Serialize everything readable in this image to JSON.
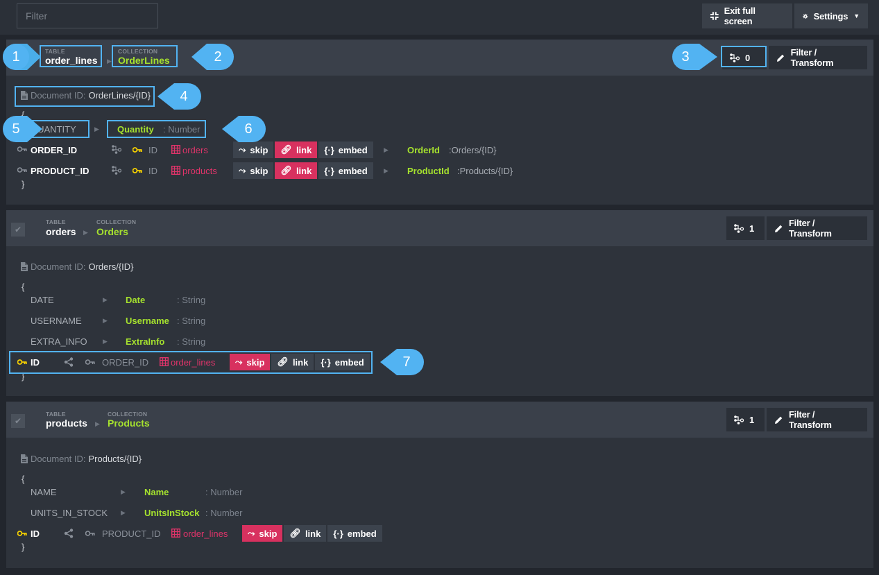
{
  "toolbar": {
    "filter_placeholder": "Filter",
    "exit_fullscreen_label": "Exit full screen",
    "settings_label": "Settings"
  },
  "panels": [
    {
      "table_caption": "TABLE",
      "table_name": "order_lines",
      "collection_caption": "COLLECTION",
      "collection_name": "OrderLines",
      "relations_count": "0",
      "filter_label": "Filter / Transform",
      "docid_label": "Document ID:",
      "docid_value": "OrderLines/{ID}",
      "brace_open": "{",
      "brace_close": "}",
      "fields": [
        {
          "column": "QUANTITY",
          "property": "Quantity",
          "type": ": Number"
        }
      ],
      "links": [
        {
          "column": "ORDER_ID",
          "key": "ID",
          "target": "orders",
          "skip": "skip",
          "link": "link",
          "embed": "embed",
          "property": "OrderId",
          "value": ":Orders/{ID}"
        },
        {
          "column": "PRODUCT_ID",
          "key": "ID",
          "target": "products",
          "skip": "skip",
          "link": "link",
          "embed": "embed",
          "property": "ProductId",
          "value": ":Products/{ID}"
        }
      ]
    },
    {
      "table_caption": "TABLE",
      "table_name": "orders",
      "collection_caption": "COLLECTION",
      "collection_name": "Orders",
      "relations_count": "1",
      "filter_label": "Filter / Transform",
      "docid_label": "Document ID:",
      "docid_value": "Orders/{ID}",
      "brace_open": "{",
      "brace_close": "}",
      "fields": [
        {
          "column": "DATE",
          "property": "Date",
          "type": ": String"
        },
        {
          "column": "USERNAME",
          "property": "Username",
          "type": ": String"
        },
        {
          "column": "EXTRA_INFO",
          "property": "ExtraInfo",
          "type": ": String"
        }
      ],
      "relation": {
        "pk": "ID",
        "fk": "ORDER_ID",
        "target": "order_lines",
        "skip": "skip",
        "link": "link",
        "embed": "embed"
      }
    },
    {
      "table_caption": "TABLE",
      "table_name": "products",
      "collection_caption": "COLLECTION",
      "collection_name": "Products",
      "relations_count": "1",
      "filter_label": "Filter / Transform",
      "docid_label": "Document ID:",
      "docid_value": "Products/{ID}",
      "brace_open": "{",
      "brace_close": "}",
      "fields": [
        {
          "column": "NAME",
          "property": "Name",
          "type": ": Number"
        },
        {
          "column": "UNITS_IN_STOCK",
          "property": "UnitsInStock",
          "type": ": Number"
        }
      ],
      "relation": {
        "pk": "ID",
        "fk": "PRODUCT_ID",
        "target": "order_lines",
        "skip": "skip",
        "link": "link",
        "embed": "embed"
      }
    }
  ],
  "callouts": [
    "1",
    "2",
    "3",
    "4",
    "5",
    "6",
    "7"
  ],
  "colors": {
    "accent_green": "#a6e22e",
    "accent_pink": "#d8315f",
    "callout_blue": "#52b3f2",
    "key_yellow": "#f5d000"
  }
}
